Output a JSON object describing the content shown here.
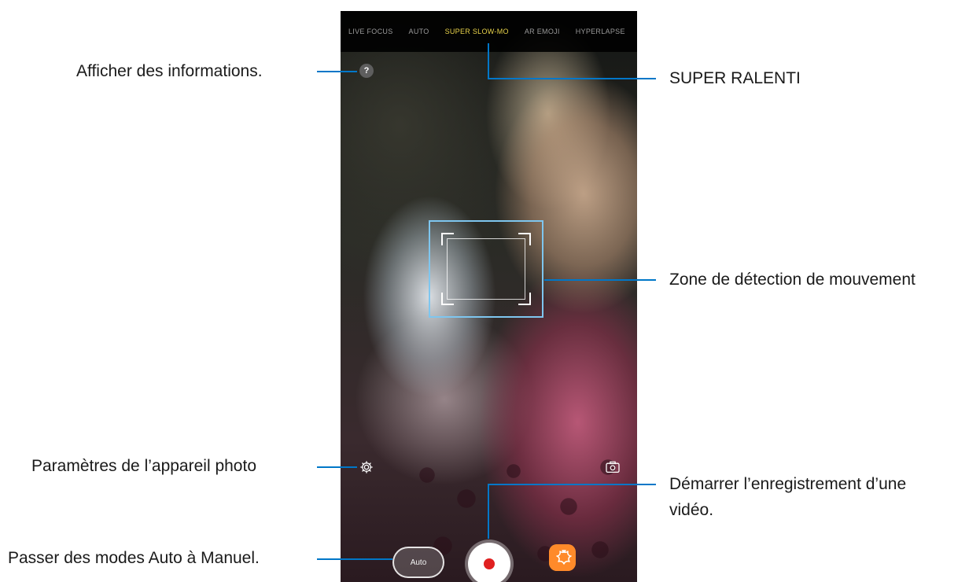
{
  "camera": {
    "modes": [
      "LIVE FOCUS",
      "AUTO",
      "SUPER SLOW-MO",
      "AR EMOJI",
      "HYPERLAPSE"
    ],
    "active_mode_index": 2,
    "info_icon_label": "?",
    "auto_button_label": "Auto",
    "icons": {
      "info": "question-circle-icon",
      "settings": "gear-icon",
      "switch_camera": "switch-camera-icon",
      "record": "record-button",
      "effects": "bixby-vision-icon"
    }
  },
  "annotations": {
    "info": "Afficher des informations.",
    "super_slow": "SUPER RALENTI",
    "motion_zone": "Zone de détection de mouvement",
    "settings": "Paramètres de l’appareil photo",
    "record_line1": "Démarrer l’enregistrement d’une",
    "record_line2": "vidéo.",
    "auto_manual": "Passer des modes Auto à Manuel."
  },
  "colors": {
    "callout_line": "#0077c8",
    "active_mode": "#e8d24a",
    "record_dot": "#e02020"
  }
}
